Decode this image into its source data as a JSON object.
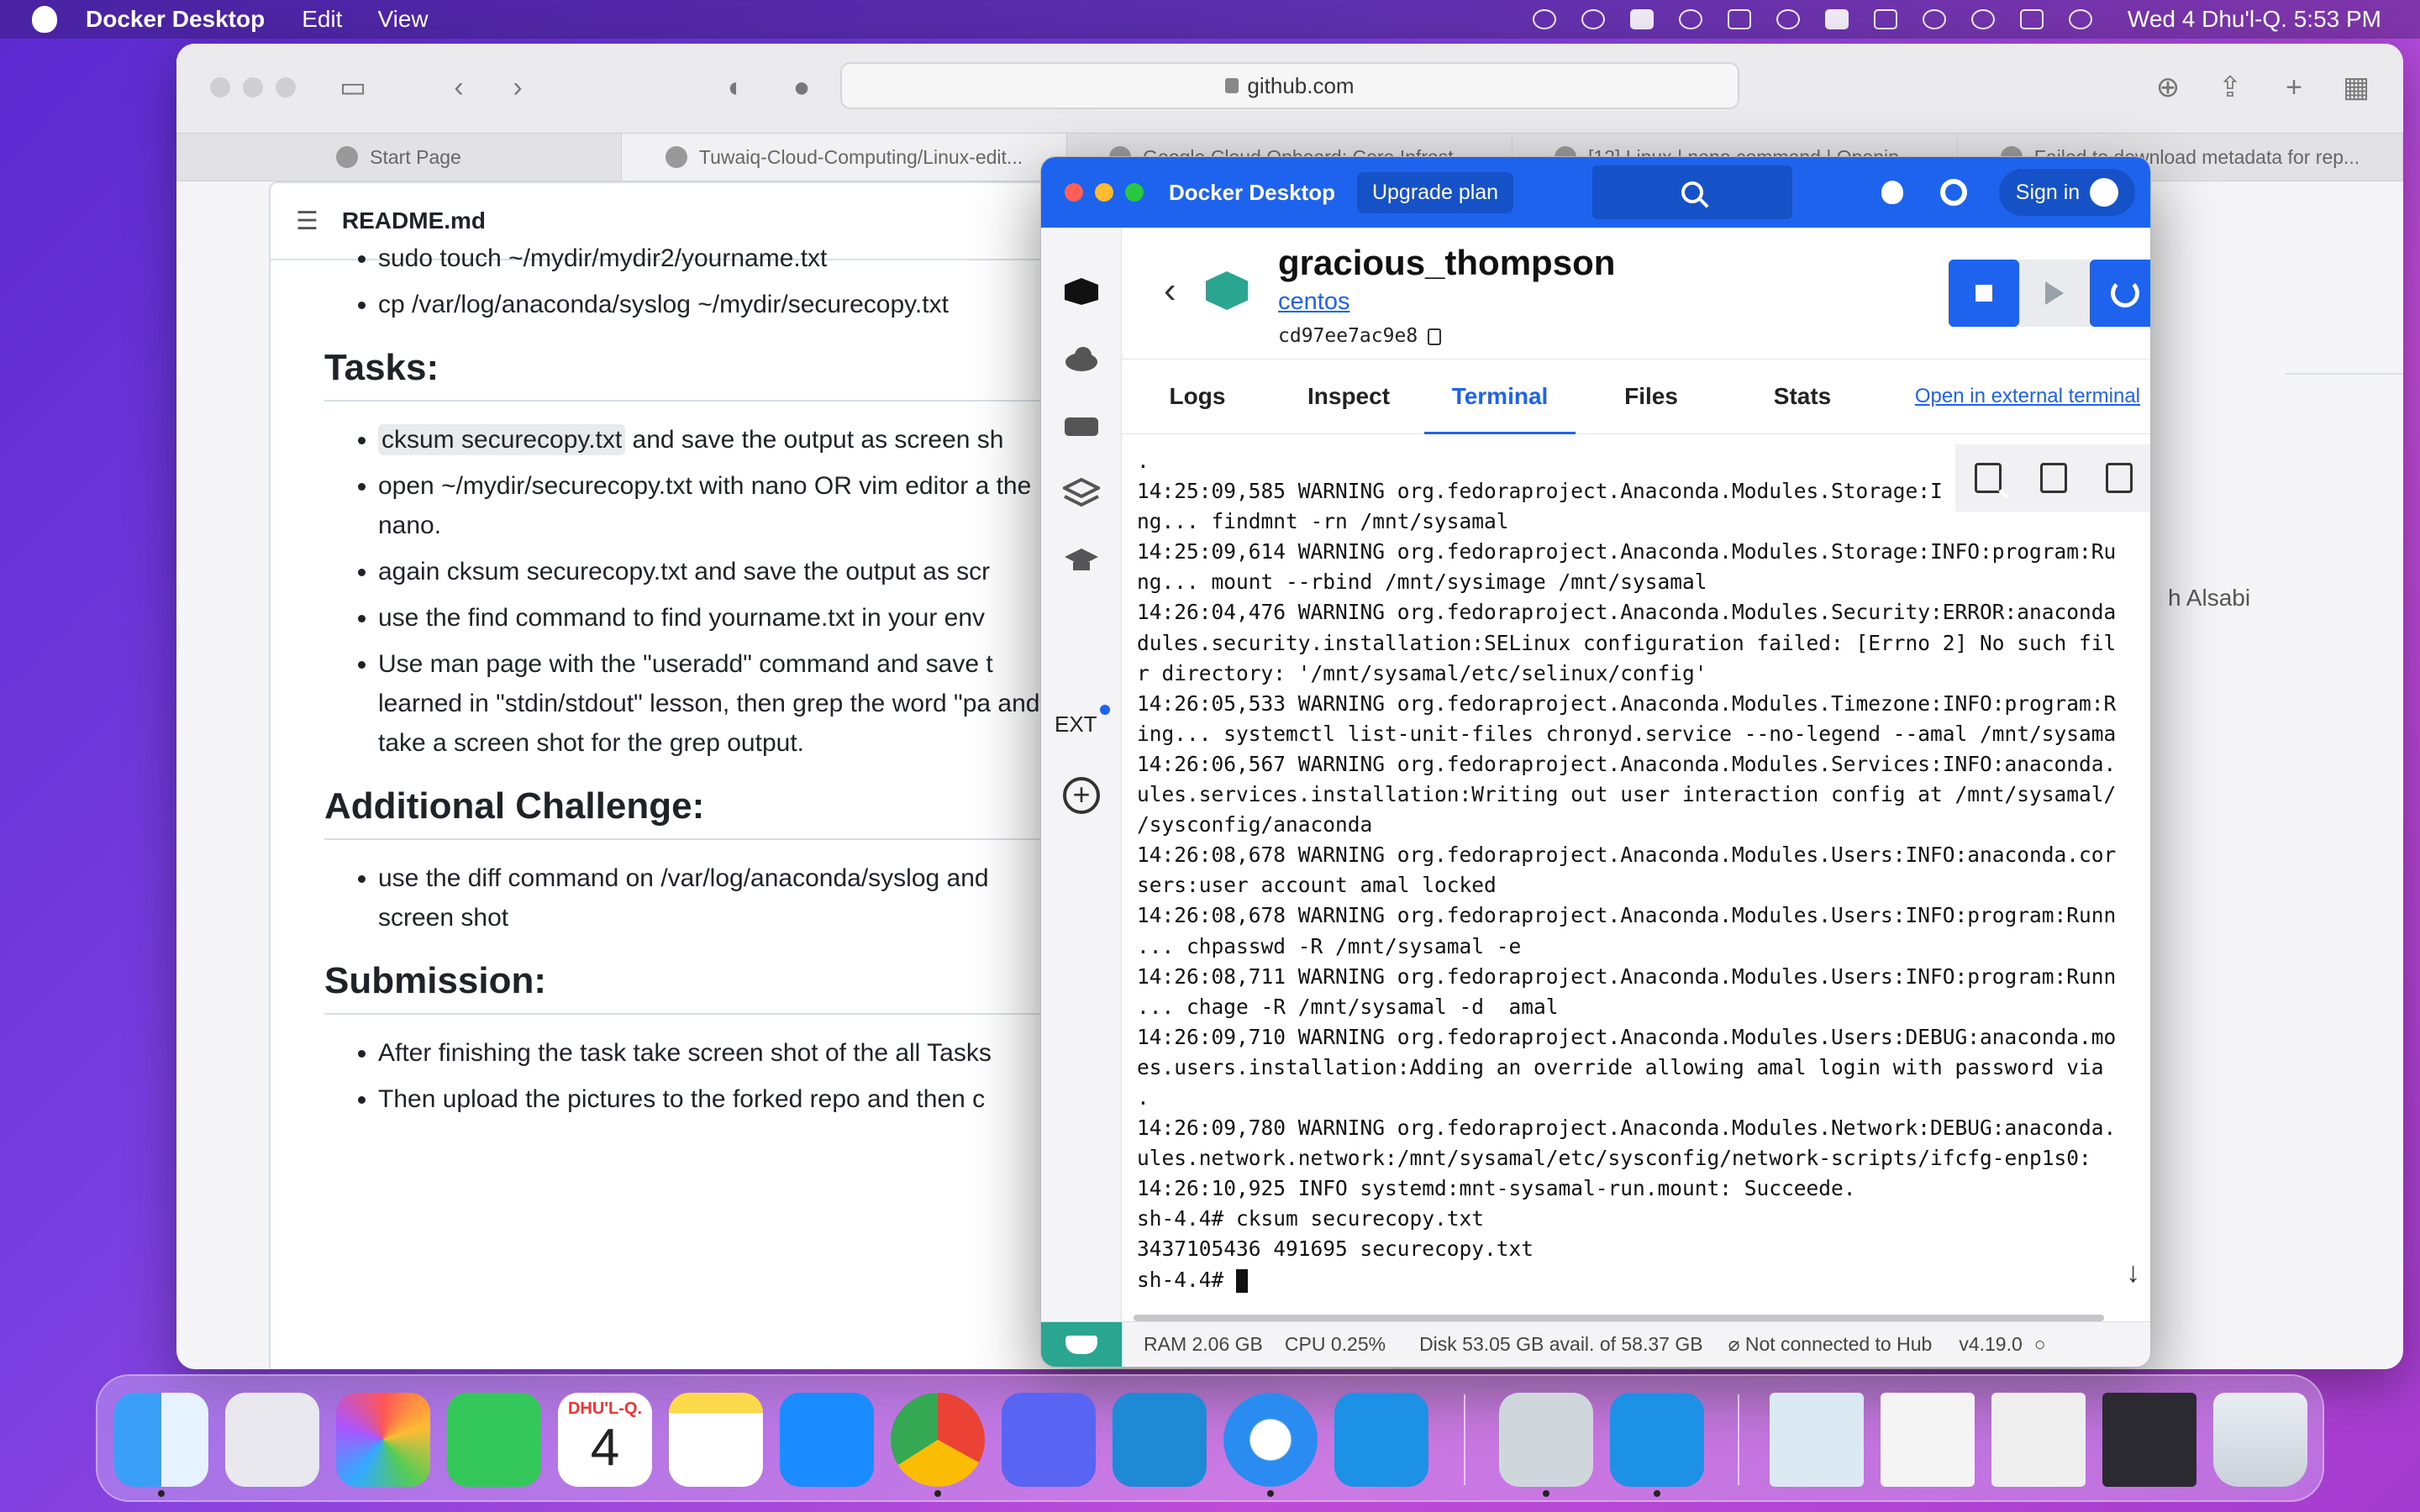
{
  "menubar": {
    "app_name": "Docker Desktop",
    "menus": [
      "Edit",
      "View"
    ],
    "clock": "Wed 4 Dhu'l-Q.  5:53 PM"
  },
  "safari": {
    "url": "github.com",
    "tabs": [
      {
        "label": "Start Page"
      },
      {
        "label": "Tuwaiq-Cloud-Computing/Linux-edit..."
      },
      {
        "label": "Google Cloud Onboard: Core Infrast..."
      },
      {
        "label": "[12] Linux | nano command | Openin..."
      },
      {
        "label": "Failed to download metadata for rep..."
      }
    ]
  },
  "readme": {
    "filename": "README.md",
    "pre_list": [
      "sudo touch ~/mydir/mydir2/yourname.txt",
      "cp /var/log/anaconda/syslog ~/mydir/securecopy.txt"
    ],
    "tasks_heading": "Tasks:",
    "tasks": [
      {
        "code": "cksum securecopy.txt",
        "text": " and save the output as screen sh"
      },
      {
        "text": "open ~/mydir/securecopy.txt with nano OR vim editor a the nano."
      },
      {
        "text": "again cksum securecopy.txt and save the output as scr"
      },
      {
        "text": "use the find command to find yourname.txt in your env"
      },
      {
        "text": "Use man page with the \"useradd\" command and save t learned in \"stdin/stdout\" lesson, then grep the word \"pa and take a screen shot for the grep output."
      }
    ],
    "challenge_heading": "Additional Challenge:",
    "challenge": [
      "use the diff command on /var/log/anaconda/syslog and screen shot"
    ],
    "submission_heading": "Submission:",
    "submission": [
      "After finishing the task take screen shot of the all Tasks",
      "Then upload the pictures to the forked repo and then c"
    ],
    "side_name": "h Alsabi"
  },
  "docker": {
    "title": "Docker Desktop",
    "upgrade": "Upgrade plan",
    "sign_in": "Sign in",
    "ext_label": "EXT",
    "container": {
      "name": "gracious_thompson",
      "image": "centos",
      "id": "cd97ee7ac9e8"
    },
    "tabs": [
      "Logs",
      "Inspect",
      "Terminal",
      "Files",
      "Stats"
    ],
    "active_tab": "Terminal",
    "external_terminal": "Open in external terminal",
    "terminal_lines": [
      ".",
      "14:25:09,585 WARNING org.fedoraproject.Anaconda.Modules.Storage:I",
      "ng... findmnt -rn /mnt/sysamal",
      "14:25:09,614 WARNING org.fedoraproject.Anaconda.Modules.Storage:INFO:program:Ru",
      "ng... mount --rbind /mnt/sysimage /mnt/sysamal",
      "14:26:04,476 WARNING org.fedoraproject.Anaconda.Modules.Security:ERROR:anaconda",
      "dules.security.installation:SELinux configuration failed: [Errno 2] No such fil",
      "r directory: '/mnt/sysamal/etc/selinux/config'",
      "14:26:05,533 WARNING org.fedoraproject.Anaconda.Modules.Timezone:INFO:program:R",
      "ing... systemctl list-unit-files chronyd.service --no-legend --amal /mnt/sysama",
      "14:26:06,567 WARNING org.fedoraproject.Anaconda.Modules.Services:INFO:anaconda.",
      "ules.services.installation:Writing out user interaction config at /mnt/sysamal/",
      "/sysconfig/anaconda",
      "14:26:08,678 WARNING org.fedoraproject.Anaconda.Modules.Users:INFO:anaconda.cor",
      "sers:user account amal locked",
      "14:26:08,678 WARNING org.fedoraproject.Anaconda.Modules.Users:INFO:program:Runn",
      "... chpasswd -R /mnt/sysamal -e",
      "14:26:08,711 WARNING org.fedoraproject.Anaconda.Modules.Users:INFO:program:Runn",
      "... chage -R /mnt/sysamal -d  amal",
      "14:26:09,710 WARNING org.fedoraproject.Anaconda.Modules.Users:DEBUG:anaconda.mo",
      "es.users.installation:Adding an override allowing amal login with password via",
      ".",
      "14:26:09,780 WARNING org.fedoraproject.Anaconda.Modules.Network:DEBUG:anaconda.",
      "ules.network.network:/mnt/sysamal/etc/sysconfig/network-scripts/ifcfg-enp1s0:",
      "14:26:10,925 INFO systemd:mnt-sysamal-run.mount: Succeede.",
      "sh-4.4# cksum securecopy.txt",
      "3437105436 491695 securecopy.txt",
      "sh-4.4# "
    ],
    "status": {
      "ram": "RAM 2.06 GB",
      "cpu": "CPU 0.25%",
      "disk": "Disk 53.05 GB avail. of 58.37 GB",
      "hub": "Not connected to Hub",
      "version": "v4.19.0"
    }
  },
  "dock": {
    "calendar_month": "DHU'L-Q.",
    "calendar_day": "4"
  },
  "colors": {
    "docker_blue": "#1d63ed",
    "stop_red": "#d92d2a",
    "docker_green": "#2aa58f"
  }
}
